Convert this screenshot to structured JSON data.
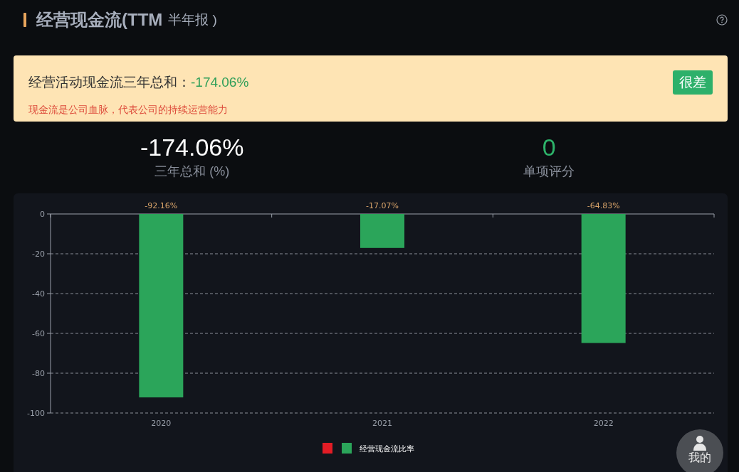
{
  "header": {
    "title": "经营现金流(TTM",
    "subtitle": "半年报 )"
  },
  "banner": {
    "label": "经营活动现金流三年总和：",
    "value": "-174.06%",
    "note": "现金流是公司血脉，代表公司的持续运营能力",
    "rating": "很差"
  },
  "stats": [
    {
      "value": "-174.06%",
      "label": "三年总和 (%)",
      "kind": "neutral"
    },
    {
      "value": "0",
      "label": "单项评分",
      "kind": "score"
    }
  ],
  "chart_data": {
    "type": "bar",
    "categories": [
      "2020",
      "2021",
      "2022"
    ],
    "series": [
      {
        "name": "经营现金流比率",
        "color": "#2ba55a",
        "values": [
          -92.16,
          -17.07,
          -64.83
        ]
      }
    ],
    "grid": true,
    "ylim": [
      -100,
      0
    ],
    "yticks": [
      0,
      -20,
      -40,
      -60,
      -80,
      -100
    ],
    "value_labels": [
      "-92.16%",
      "-17.07%",
      "-64.83%"
    ]
  },
  "legend_swatches": [
    {
      "color": "#e31c25"
    },
    {
      "color": "#2ba55a"
    }
  ],
  "float_button": {
    "label": "我的"
  }
}
